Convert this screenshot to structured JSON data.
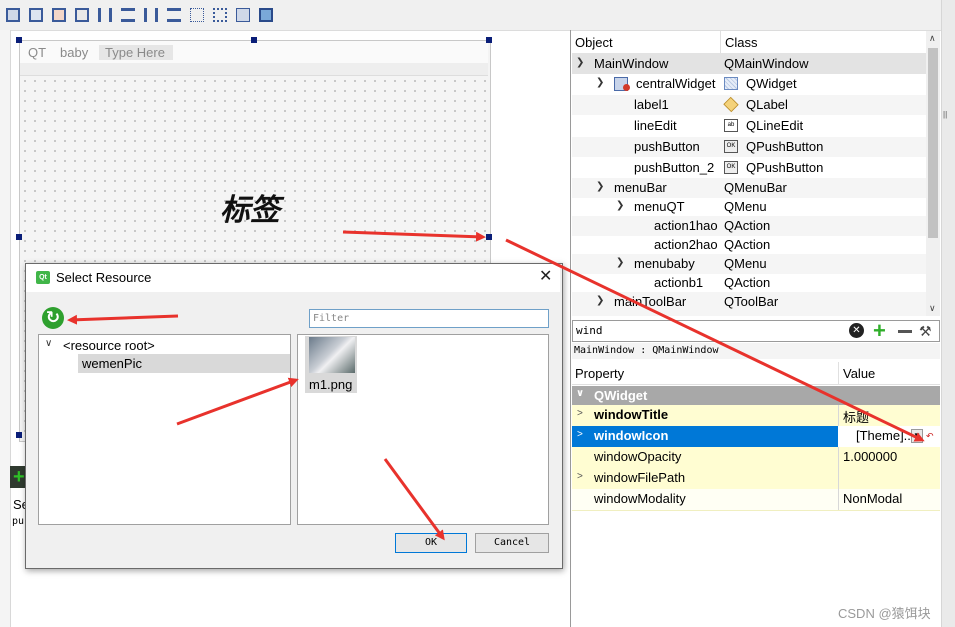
{
  "form": {
    "menu": [
      "QT",
      "baby"
    ],
    "type_here": "Type Here",
    "label_text": "标签"
  },
  "bottom_left": {
    "se_text": "Se",
    "pus_text": "pus"
  },
  "object_inspector": {
    "headers": {
      "object": "Object",
      "class": "Class"
    },
    "rows": [
      {
        "name": "MainWindow",
        "class": "QMainWindow"
      },
      {
        "name": "centralWidget",
        "class": "QWidget"
      },
      {
        "name": "label1",
        "class": "QLabel"
      },
      {
        "name": "lineEdit",
        "class": "QLineEdit"
      },
      {
        "name": "pushButton",
        "class": "QPushButton"
      },
      {
        "name": "pushButton_2",
        "class": "QPushButton"
      },
      {
        "name": "menuBar",
        "class": "QMenuBar"
      },
      {
        "name": "menuQT",
        "class": "QMenu"
      },
      {
        "name": "action1hao",
        "class": "QAction"
      },
      {
        "name": "action2hao",
        "class": "QAction"
      },
      {
        "name": "menubaby",
        "class": "QMenu"
      },
      {
        "name": "actionb1",
        "class": "QAction"
      },
      {
        "name": "mainToolBar",
        "class": "QToolBar"
      }
    ]
  },
  "property_editor": {
    "filter_value": "wind",
    "object_path": "MainWindow : QMainWindow",
    "headers": {
      "property": "Property",
      "value": "Value"
    },
    "group": "QWidget",
    "rows": [
      {
        "name": "windowTitle",
        "value": "标题"
      },
      {
        "name": "windowIcon",
        "value": "[Theme]..."
      },
      {
        "name": "windowOpacity",
        "value": "1.000000"
      },
      {
        "name": "windowFilePath",
        "value": ""
      },
      {
        "name": "windowModality",
        "value": "NonModal"
      }
    ]
  },
  "dialog": {
    "title": "Select Resource",
    "filter_placeholder": "Filter",
    "tree": {
      "root": "<resource root>",
      "child": "wemenPic"
    },
    "file": "m1.png",
    "ok": "OK",
    "cancel": "Cancel"
  },
  "watermark": "CSDN @猿饵块",
  "colors": {
    "selection": "#0078d7",
    "property_row": "#fffdd2",
    "arrow": "#e8322c"
  }
}
